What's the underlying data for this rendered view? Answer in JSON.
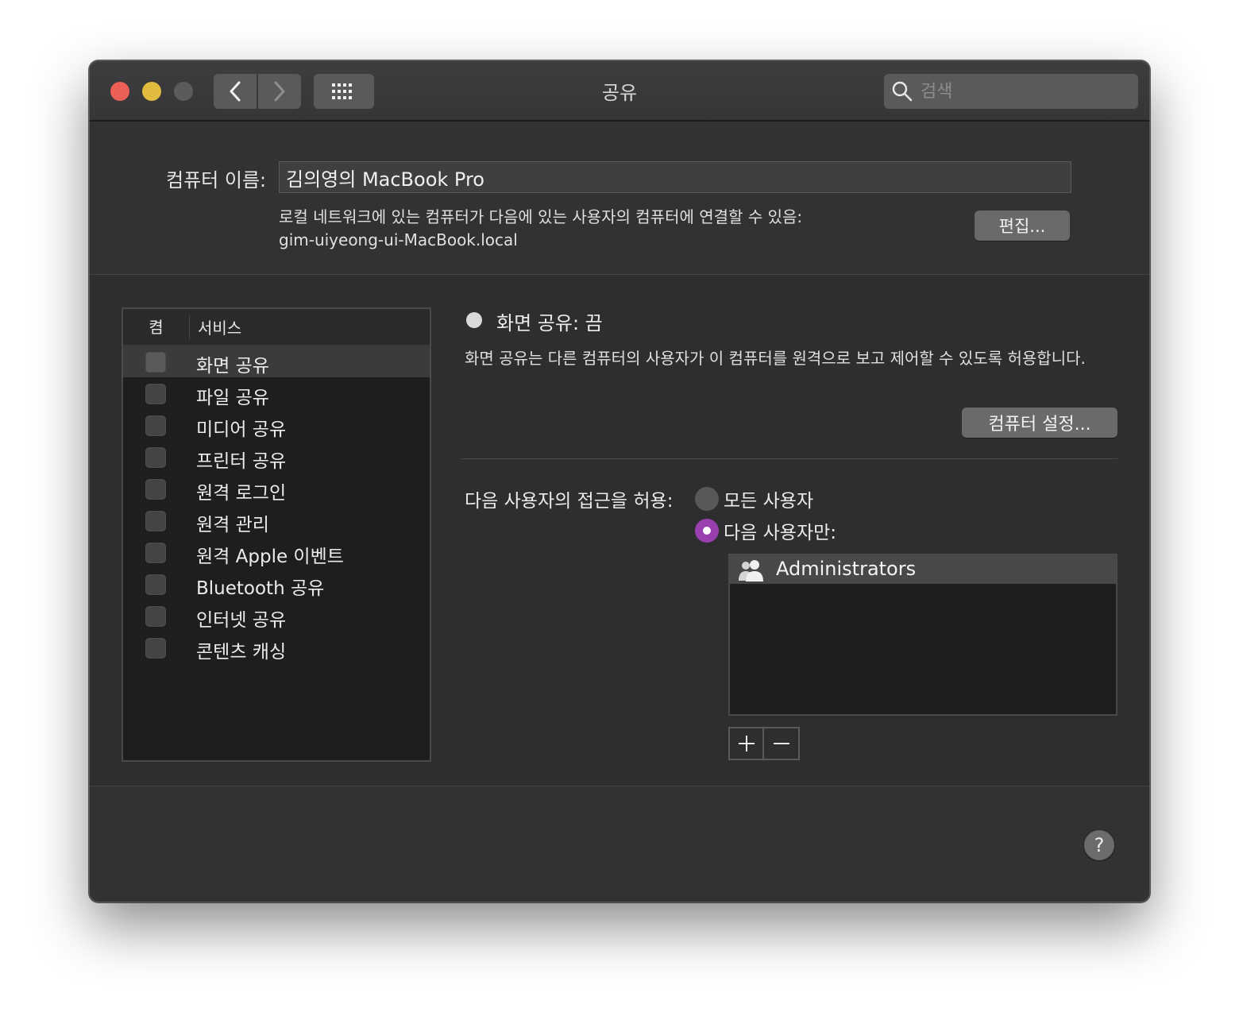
{
  "window": {
    "title": "공유"
  },
  "search": {
    "placeholder": "검색",
    "value": ""
  },
  "computer_name": {
    "label": "컴퓨터 이름:",
    "value": "김의영의 MacBook Pro",
    "local_description": "로컬 네트워크에 있는 컴퓨터가 다음에 있는 사용자의 컴퓨터에 연결할 수 있음:",
    "local_hostname": "gim-uiyeong-ui-MacBook.local",
    "edit_label": "편집..."
  },
  "services": {
    "col_on": "켬",
    "col_service": "서비스",
    "items": [
      {
        "label": "화면 공유",
        "checked": false,
        "selected": true
      },
      {
        "label": "파일 공유",
        "checked": false,
        "selected": false
      },
      {
        "label": "미디어 공유",
        "checked": false,
        "selected": false
      },
      {
        "label": "프린터 공유",
        "checked": false,
        "selected": false
      },
      {
        "label": "원격 로그인",
        "checked": false,
        "selected": false
      },
      {
        "label": "원격 관리",
        "checked": false,
        "selected": false
      },
      {
        "label": "원격 Apple 이벤트",
        "checked": false,
        "selected": false
      },
      {
        "label": "Bluetooth 공유",
        "checked": false,
        "selected": false
      },
      {
        "label": "인터넷 공유",
        "checked": false,
        "selected": false
      },
      {
        "label": "콘텐츠 캐싱",
        "checked": false,
        "selected": false
      }
    ]
  },
  "detail": {
    "status": "화면 공유: 끔",
    "description": "화면 공유는 다른 컴퓨터의 사용자가 이 컴퓨터를 원격으로 보고 제어할 수 있도록 허용합니다.",
    "computer_settings_label": "컴퓨터 설정...",
    "access_label": "다음 사용자의 접근을 허용:",
    "option_all": "모든 사용자",
    "option_only": "다음 사용자만:",
    "selected_option": "only",
    "users": [
      "Administrators"
    ]
  },
  "colors": {
    "accent": "#9a3fb0",
    "close": "#ec5f57",
    "minimize": "#e0bb3d"
  },
  "icons": {
    "back": "chevron-left-icon",
    "forward": "chevron-right-icon",
    "grid": "grid-icon",
    "search": "search-icon",
    "group": "user-group-icon",
    "add": "plus-icon",
    "remove": "minus-icon",
    "help": "question-icon"
  },
  "help_label": "?"
}
